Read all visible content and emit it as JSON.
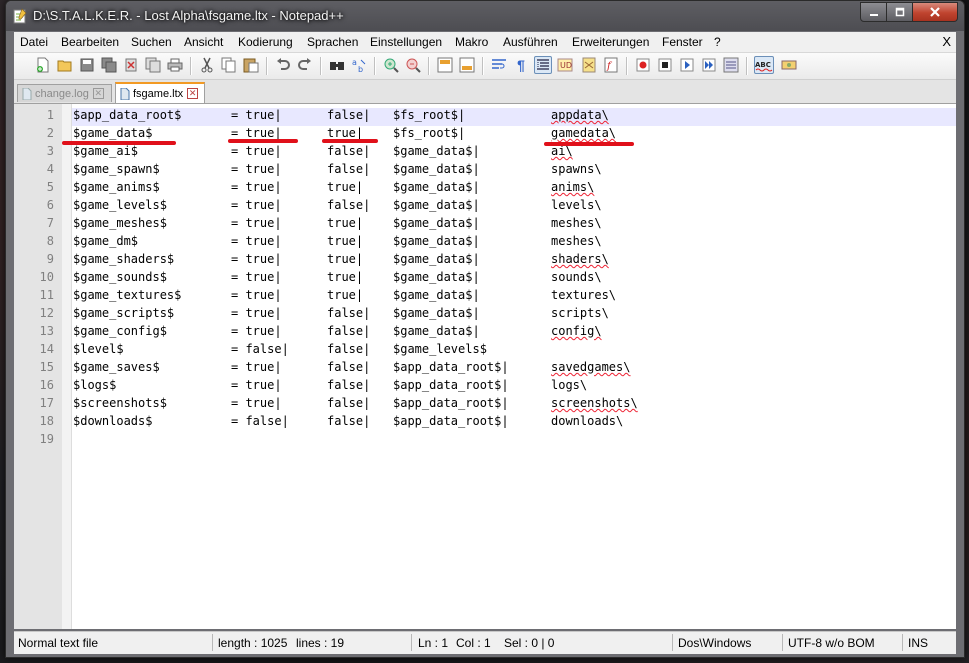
{
  "window": {
    "title": "D:\\S.T.A.L.K.E.R. - Lost Alpha\\fsgame.ltx - Notepad++"
  },
  "menu": {
    "items": [
      "Datei",
      "Bearbeiten",
      "Suchen",
      "Ansicht",
      "Kodierung",
      "Sprachen",
      "Einstellungen",
      "Makro",
      "Ausführen",
      "Erweiterungen",
      "Fenster",
      "?"
    ],
    "close_label": "X"
  },
  "toolbar": {
    "icons": [
      "new-file-icon",
      "open-file-icon",
      "save-icon",
      "save-all-icon",
      "close-icon",
      "close-all-icon",
      "print-icon",
      "cut-icon",
      "copy-icon",
      "paste-icon",
      "undo-icon",
      "redo-icon",
      "find-icon",
      "replace-icon",
      "zoom-in-icon",
      "zoom-out-icon",
      "sync-vertical-icon",
      "sync-horizontal-icon",
      "word-wrap-icon",
      "show-all-chars-icon",
      "indent-guide-icon",
      "user-language-icon",
      "doc-map-icon",
      "function-list-icon",
      "record-macro-icon",
      "stop-record-icon",
      "play-macro-icon",
      "run-macro-multiple-icon",
      "save-macro-icon",
      "spell-check-icon",
      "spell-check-settings-icon"
    ]
  },
  "tabs": [
    {
      "label": "change.log",
      "active": false
    },
    {
      "label": "fsgame.ltx",
      "active": true
    }
  ],
  "editor": {
    "line_numbers": [
      "1",
      "2",
      "3",
      "4",
      "5",
      "6",
      "7",
      "8",
      "9",
      "10",
      "11",
      "12",
      "13",
      "14",
      "15",
      "16",
      "17",
      "18",
      "19"
    ],
    "lines": [
      {
        "c1": "$app_data_root$",
        "c2": "= true|",
        "c3": "false|",
        "c4": "$fs_root$|",
        "c5": "appdata\\"
      },
      {
        "c1": "$game_data$",
        "c2": "= true|",
        "c3": "true|",
        "c4": "$fs_root$|",
        "c5": "gamedata\\"
      },
      {
        "c1": "$game_ai$",
        "c2": "= true|",
        "c3": "false|",
        "c4": "$game_data$|",
        "c5": "ai\\"
      },
      {
        "c1": "$game_spawn$",
        "c2": "= true|",
        "c3": "false|",
        "c4": "$game_data$|",
        "c5": "spawns\\"
      },
      {
        "c1": "$game_anims$",
        "c2": "= true|",
        "c3": "true|",
        "c4": "$game_data$|",
        "c5": "anims\\"
      },
      {
        "c1": "$game_levels$",
        "c2": "= true|",
        "c3": "false|",
        "c4": "$game_data$|",
        "c5": "levels\\"
      },
      {
        "c1": "$game_meshes$",
        "c2": "= true|",
        "c3": "true|",
        "c4": "$game_data$|",
        "c5": "meshes\\"
      },
      {
        "c1": "$game_dm$",
        "c2": "= true|",
        "c3": "true|",
        "c4": "$game_data$|",
        "c5": "meshes\\"
      },
      {
        "c1": "$game_shaders$",
        "c2": "= true|",
        "c3": "true|",
        "c4": "$game_data$|",
        "c5": "shaders\\"
      },
      {
        "c1": "$game_sounds$",
        "c2": "= true|",
        "c3": "true|",
        "c4": "$game_data$|",
        "c5": "sounds\\"
      },
      {
        "c1": "$game_textures$",
        "c2": "= true|",
        "c3": "true|",
        "c4": "$game_data$|",
        "c5": "textures\\"
      },
      {
        "c1": "$game_scripts$",
        "c2": "= true|",
        "c3": "false|",
        "c4": "$game_data$|",
        "c5": "scripts\\"
      },
      {
        "c1": "$game_config$",
        "c2": "= true|",
        "c3": "false|",
        "c4": "$game_data$|",
        "c5": "config\\"
      },
      {
        "c1": "$level$",
        "c2": "= false|",
        "c3": "false|",
        "c4": "$game_levels$",
        "c5": ""
      },
      {
        "c1": "$game_saves$",
        "c2": "= true|",
        "c3": "false|",
        "c4": "$app_data_root$|",
        "c5": "savedgames\\"
      },
      {
        "c1": "$logs$",
        "c2": "= true|",
        "c3": "false|",
        "c4": "$app_data_root$|",
        "c5": "logs\\"
      },
      {
        "c1": "$screenshots$",
        "c2": "= true|",
        "c3": "false|",
        "c4": "$app_data_root$|",
        "c5": "screenshots\\"
      },
      {
        "c1": "$downloads$",
        "c2": "= false|",
        "c3": "false|",
        "c4": "$app_data_root$|",
        "c5": "downloads\\"
      },
      {
        "c1": "",
        "c2": "",
        "c3": "",
        "c4": "",
        "c5": ""
      }
    ]
  },
  "statusbar": {
    "file_type": "Normal text file",
    "length": "length : 1025",
    "lines": "lines : 19",
    "ln": "Ln : 1",
    "col": "Col : 1",
    "sel": "Sel : 0 | 0",
    "eol": "Dos\\Windows",
    "encoding": "UTF-8 w/o BOM",
    "mode": "INS"
  },
  "colors": {
    "annotation_red": "#e0101a",
    "current_line": "#e8e8ff",
    "active_tab_accent": "#f29a24"
  }
}
